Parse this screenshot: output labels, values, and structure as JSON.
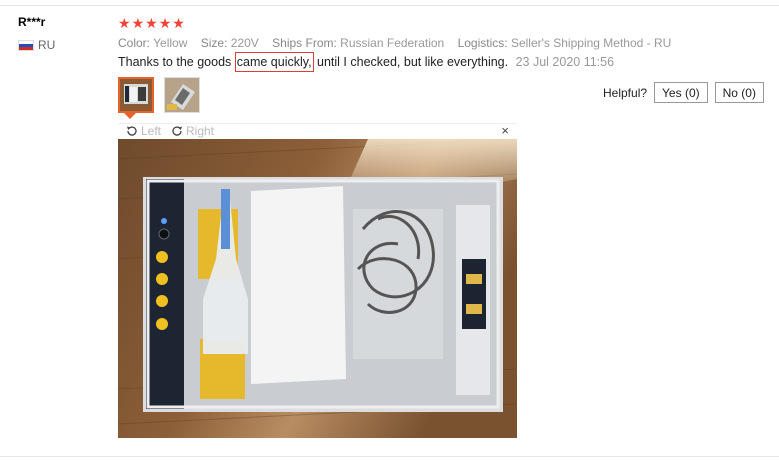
{
  "review": {
    "user": "R***r",
    "country": "RU",
    "rating_stars": 5,
    "meta": {
      "color_label": "Color:",
      "color_value": "Yellow",
      "size_label": "Size:",
      "size_value": "220V",
      "ships_label": "Ships From:",
      "ships_value": "Russian Federation",
      "logistics_label": "Logistics:",
      "logistics_value": "Seller's Shipping Method - RU"
    },
    "text_before": "Thanks to the goods ",
    "text_highlight": "came quickly,",
    "text_after": " until I checked, but like everything.",
    "date": "23 Jul 2020 11:56",
    "helpful": {
      "label": "Helpful?",
      "yes": "Yes (0)",
      "no": "No (0)"
    },
    "viewer": {
      "left": "Left",
      "right": "Right",
      "close": "×"
    }
  },
  "icons": {
    "rotate_left": "rotate-left-icon",
    "rotate_right": "rotate-right-icon",
    "close": "close-icon",
    "star": "star-icon",
    "flag": "russia-flag-icon"
  },
  "colors": {
    "star": "#f44336",
    "highlight_border": "#d9403a",
    "active_thumb": "#e8632b"
  }
}
